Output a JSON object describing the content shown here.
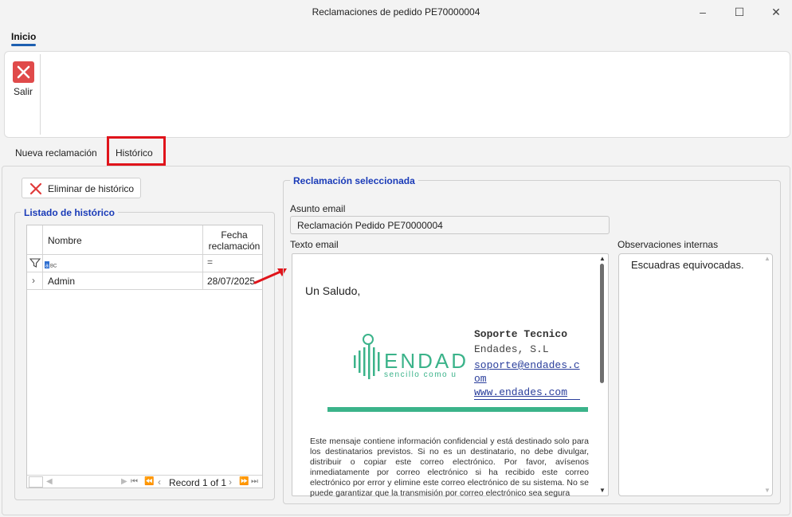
{
  "window": {
    "title": "Reclamaciones de pedido PE70000004",
    "minimize": "–",
    "maximize": "☐",
    "close": "✕"
  },
  "ribbon": {
    "tab": "Inicio",
    "salir_label": "Salir"
  },
  "tabs": [
    {
      "label": "Nueva reclamación",
      "active": false
    },
    {
      "label": "Histórico",
      "active": true
    }
  ],
  "historico": {
    "delete_button": "Eliminar de histórico",
    "group_title": "Listado de histórico",
    "columns": [
      "Nombre",
      "Fecha reclamación"
    ],
    "filter_row": {
      "nombre_filter": "",
      "fecha_filter": "="
    },
    "rows": [
      {
        "nombre": "Admin",
        "fecha": "28/07/2025"
      }
    ],
    "pager": "Record 1 of 1"
  },
  "seleccionada": {
    "group_title": "Reclamación seleccionada",
    "asunto_label": "Asunto email",
    "asunto_value": "Reclamación Pedido PE70000004",
    "texto_label": "Texto email",
    "obs_label": "Observaciones internas",
    "obs_value": "Escuadras equivocadas."
  },
  "email": {
    "greeting": "Un Saludo,",
    "logo_text": "ENDAD",
    "logo_tagline": "sencillo como u",
    "signature": {
      "name": "Soporte Tecnico",
      "company": "Endades, S.L",
      "email_line1": "soporte@endades.c",
      "email_line2": "om",
      "web": "www.endades.com"
    },
    "disclaimer": "Este mensaje contiene información confidencial y está destinado solo para los destinatarios previstos. Si no es un destinatario, no debe divulgar, distribuir o copiar este correo electrónico. Por favor, avísenos inmediatamente por correo electrónico si ha recibido este correo electrónico por error y elimine este correo electrónico de su sistema. No se puede garantizar que la transmisión por correo electrónico sea segura"
  },
  "colors": {
    "accent": "#1d5fb0",
    "group_title": "#1a3bb8",
    "highlight_box": "#e0141b",
    "logo_green": "#3bb38a",
    "danger": "#e04a4a"
  }
}
